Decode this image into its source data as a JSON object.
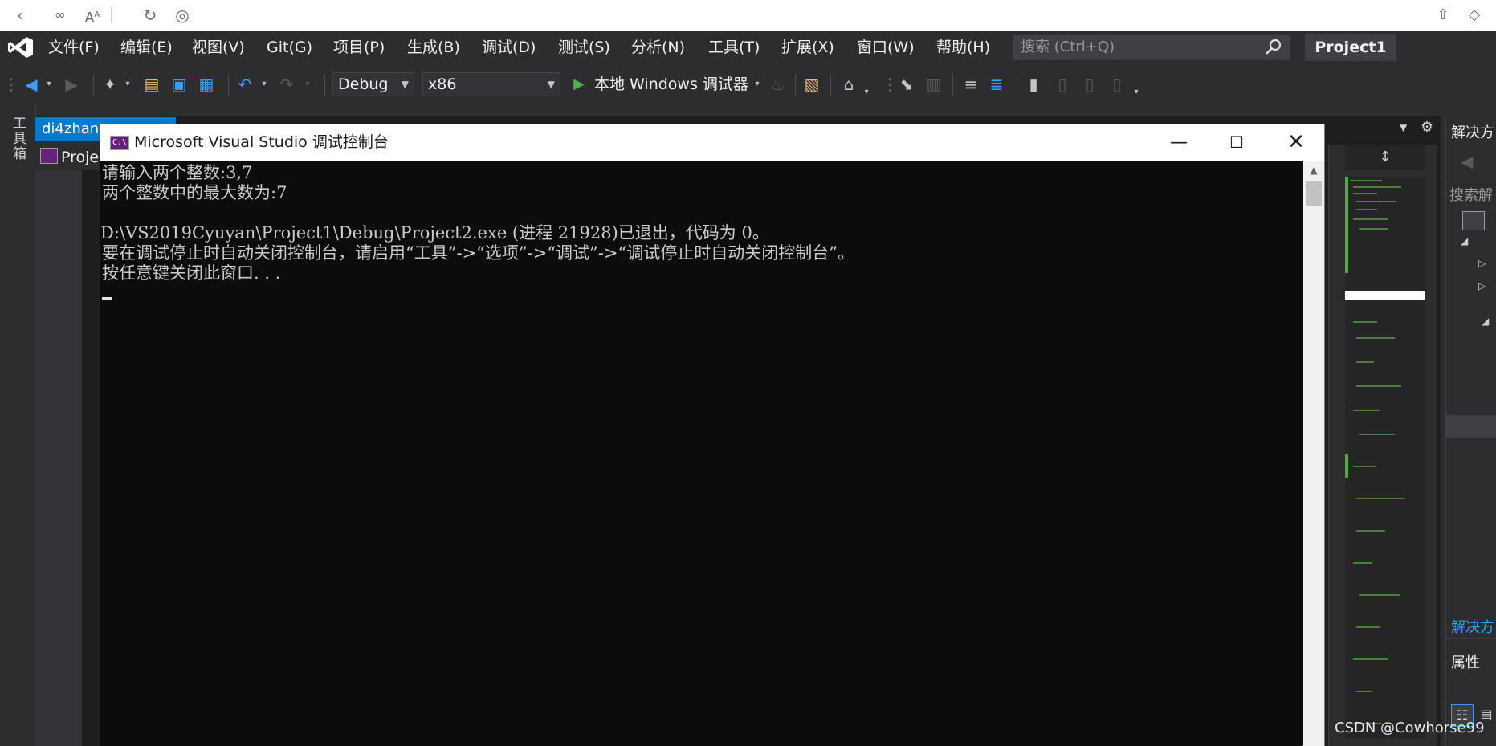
{
  "topstrip": {
    "icons": [
      "back-icon",
      "link-icon",
      "text-size-icon",
      "refresh-icon",
      "compass-icon",
      "share-icon",
      "cube-icon"
    ]
  },
  "menubar": {
    "items": [
      "文件(F)",
      "编辑(E)",
      "视图(V)",
      "Git(G)",
      "项目(P)",
      "生成(B)",
      "调试(D)",
      "测试(S)",
      "分析(N)",
      "工具(T)",
      "扩展(X)",
      "窗口(W)",
      "帮助(H)"
    ],
    "search_placeholder": "搜索 (Ctrl+Q)",
    "project_title": "Project1"
  },
  "toolbar": {
    "config": "Debug",
    "platform": "x86",
    "run_label": "本地 Windows 调试器"
  },
  "left_strip": {
    "label": "工具箱"
  },
  "editor": {
    "doc_tab": "di4zhang",
    "project_chip": "Proje"
  },
  "console": {
    "title": "Microsoft Visual Studio 调试控制台",
    "icon_text": "C:\\",
    "lines": [
      "请输入两个整数:3,7",
      "两个整数中的最大数为:7",
      "",
      "D:\\VS2019Cyuyan\\Project1\\Debug\\Project2.exe (进程 21928)已退出，代码为 0。",
      "要在调试停止时自动关闭控制台，请启用“工具”->“选项”->“调试”->“调试停止时自动关闭控制台”。",
      "按任意键关闭此窗口. . ."
    ]
  },
  "right_panel": {
    "title": "解决方",
    "search": "搜索解",
    "bottom_link": "解决方",
    "properties": "属性"
  },
  "watermark": "CSDN @Cowhorse99",
  "colors": {
    "accent": "#007acc",
    "bg": "#2d2d30",
    "console_bg": "#0c0c0c",
    "run_green": "#4caf50"
  }
}
